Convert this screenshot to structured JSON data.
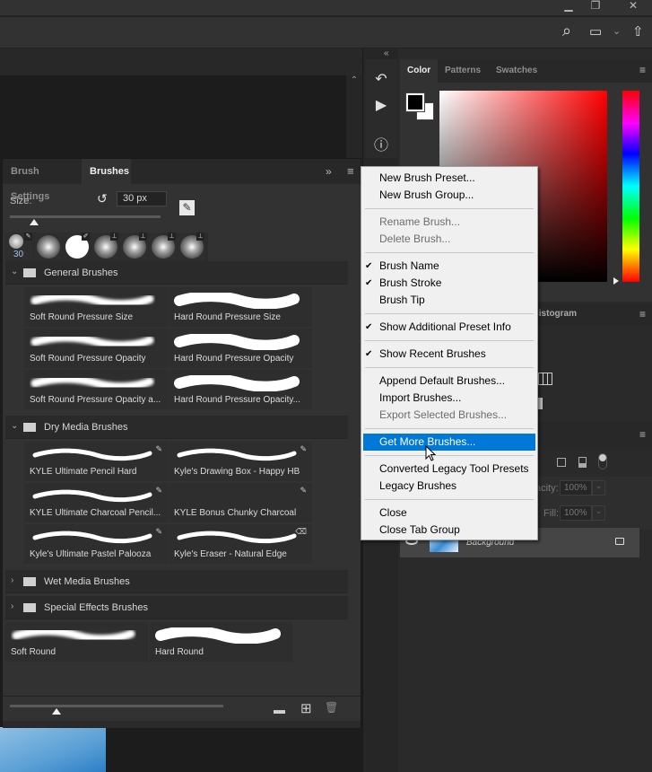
{
  "titlebar": {
    "minimize_icon": "minimize-icon",
    "restore_icon": "restore-icon",
    "close_icon": "close-icon",
    "minimize_glyph": "▁",
    "restore_glyph": "❐",
    "close_glyph": "✕"
  },
  "toolbar": {
    "search_glyph": "⌕",
    "workspace_glyph": "▭",
    "workspace_chevron": "⌄",
    "share_glyph": "⇧"
  },
  "brushes_panel": {
    "tabs": [
      {
        "label": "Brush Settings",
        "active": false
      },
      {
        "label": "Brushes",
        "active": true
      }
    ],
    "collapse_glyph": "»",
    "menu_glyph": "≡",
    "size_label": "Size:",
    "size_value": "30 px",
    "reset_glyph": "↺",
    "edit_brush_glyph": "✎",
    "size_slider_fraction": 0.16,
    "recent_brushes": [
      {
        "kind": "spatter",
        "size": "30",
        "badge": "✎"
      },
      {
        "kind": "soft",
        "badge": ""
      },
      {
        "kind": "hard",
        "badge": "✐"
      },
      {
        "kind": "soft",
        "badge": "⊥"
      },
      {
        "kind": "soft",
        "badge": "⊥"
      },
      {
        "kind": "soft",
        "badge": "⊥"
      },
      {
        "kind": "soft",
        "badge": "⊥"
      }
    ],
    "groups": [
      {
        "name": "General Brushes",
        "expanded": true,
        "expand_glyph": "⌄",
        "brushes": [
          {
            "name": "Soft Round Pressure Size",
            "kind": "soft"
          },
          {
            "name": "Hard Round Pressure Size",
            "kind": "hard"
          },
          {
            "name": "Soft Round Pressure Opacity",
            "kind": "soft"
          },
          {
            "name": "Hard Round Pressure Opacity",
            "kind": "hard"
          },
          {
            "name": "Soft Round Pressure Opacity a...",
            "kind": "soft"
          },
          {
            "name": "Hard Round Pressure Opacity...",
            "kind": "hard"
          }
        ]
      },
      {
        "name": "Dry Media Brushes",
        "expanded": true,
        "expand_glyph": "⌄",
        "brushes": [
          {
            "name": "KYLE Ultimate Pencil Hard",
            "kind": "rough",
            "tool_glyph": "✎"
          },
          {
            "name": "Kyle's Drawing Box - Happy HB",
            "kind": "rough",
            "tool_glyph": "✎"
          },
          {
            "name": "KYLE  Ultimate  Charcoal  Pencil...",
            "kind": "rough",
            "tool_glyph": "✎"
          },
          {
            "name": "KYLE Bonus Chunky Charcoal",
            "kind": "none",
            "tool_glyph": "✎"
          },
          {
            "name": "Kyle's Ultimate Pastel Palooza",
            "kind": "rough",
            "tool_glyph": "✎"
          },
          {
            "name": "Kyle's Eraser - Natural Edge",
            "kind": "rough",
            "tool_glyph": "⌫"
          }
        ]
      },
      {
        "name": "Wet Media Brushes",
        "expanded": false,
        "expand_glyph": "›"
      },
      {
        "name": "Special Effects Brushes",
        "expanded": false,
        "expand_glyph": "›"
      }
    ],
    "ungrouped_brushes": [
      {
        "name": "Soft Round",
        "kind": "soft"
      },
      {
        "name": "Hard Round",
        "kind": "hard"
      }
    ],
    "preview_slider_fraction": 0.22,
    "footer": {
      "new_group_glyph": "▬",
      "new_brush_glyph": "⊞",
      "delete_glyph": "🗑"
    }
  },
  "dock": {
    "collapse_left_glyph": "«",
    "collapse_right_glyph": "»",
    "history_glyph": "↶",
    "actions_glyph": "▶",
    "info_glyph": "ⓘ"
  },
  "color_panel": {
    "tabs": [
      {
        "label": "Color",
        "active": true
      },
      {
        "label": "Patterns",
        "active": false
      },
      {
        "label": "Swatches",
        "active": false
      }
    ],
    "menu_glyph": "≡",
    "foreground": "#000000",
    "background": "#ffffff",
    "hue": "#ff0000"
  },
  "histogram_panel": {
    "tab_label": "Histogram",
    "visible_fragment": "listogram",
    "menu_glyph": "≡"
  },
  "layers_panel": {
    "menu_glyph": "≡",
    "opacity_label": "Opacity:",
    "opacity_fragment": "acity:",
    "opacity_value": "100%",
    "fill_label": "Fill:",
    "fill_value": "100%",
    "dropdown_glyph": "⌄",
    "layer": {
      "name": "Background",
      "visible": true,
      "locked": true
    },
    "eye_glyph": "👁",
    "lock_glyph": "🔒"
  },
  "context_menu": {
    "items": [
      {
        "label": "New Brush Preset...",
        "enabled": true,
        "checked": false
      },
      {
        "label": "New Brush Group...",
        "enabled": true,
        "checked": false
      },
      {
        "sep": true
      },
      {
        "label": "Rename Brush...",
        "enabled": false,
        "checked": false
      },
      {
        "label": "Delete Brush...",
        "enabled": false,
        "checked": false
      },
      {
        "sep": true
      },
      {
        "label": "Brush Name",
        "enabled": true,
        "checked": true
      },
      {
        "label": "Brush Stroke",
        "enabled": true,
        "checked": true
      },
      {
        "label": "Brush Tip",
        "enabled": true,
        "checked": false
      },
      {
        "sep": true
      },
      {
        "label": "Show Additional Preset Info",
        "enabled": true,
        "checked": true
      },
      {
        "sep": true
      },
      {
        "label": "Show Recent Brushes",
        "enabled": true,
        "checked": true
      },
      {
        "sep": true
      },
      {
        "label": "Append Default Brushes...",
        "enabled": true,
        "checked": false
      },
      {
        "label": "Import Brushes...",
        "enabled": true,
        "checked": false
      },
      {
        "label": "Export Selected Brushes...",
        "enabled": false,
        "checked": false
      },
      {
        "sep": true
      },
      {
        "label": "Get More Brushes...",
        "enabled": true,
        "checked": false,
        "highlighted": true
      },
      {
        "sep": true
      },
      {
        "label": "Converted Legacy Tool Presets",
        "enabled": true,
        "checked": false
      },
      {
        "label": "Legacy Brushes",
        "enabled": true,
        "checked": false
      },
      {
        "sep": true
      },
      {
        "label": "Close",
        "enabled": true,
        "checked": false
      },
      {
        "label": "Close Tab Group",
        "enabled": true,
        "checked": false
      }
    ],
    "check_glyph": "✔"
  },
  "doc": {
    "scroll_up_glyph": "⌃"
  }
}
